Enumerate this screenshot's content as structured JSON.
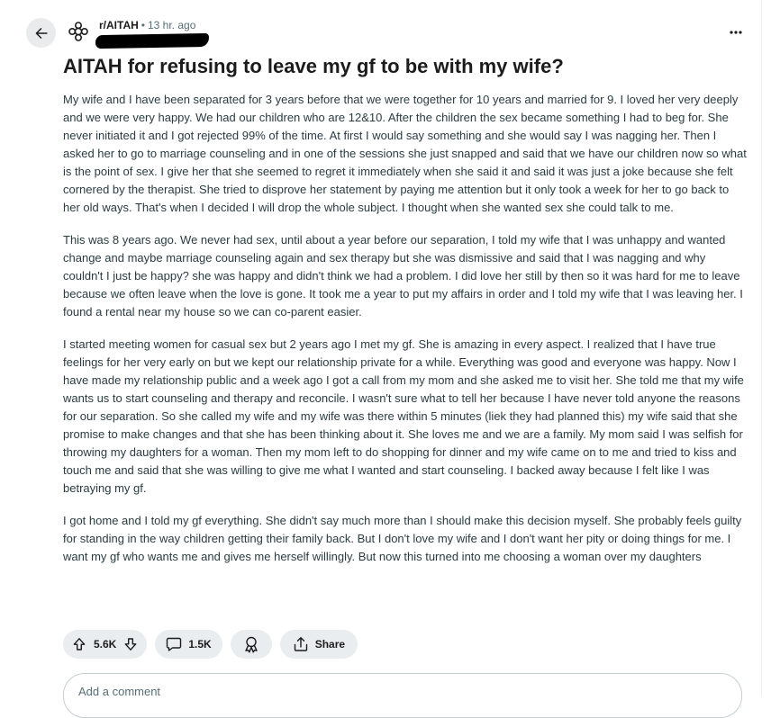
{
  "header": {
    "back_icon": "arrow-left-icon",
    "avatar_icon": "subreddit-avatar-icon",
    "subreddit": "r/AITAH",
    "separator": "•",
    "time_ago": "13 hr. ago",
    "more_icon": "ellipsis-icon"
  },
  "post": {
    "title": "AITAH for refusing to leave my gf to be with my wife?",
    "paragraphs": [
      "My wife and I have been separated for 3 years before that we were together for 10 years and married for 9. I loved her very deeply and we were very happy. We had our children who are 12&10. After the children the sex became something I had to beg for. She never initiated it and I got rejected 99% of the time. At first I would say something and she would say I was nagging her. Then I asked her to go to marriage counseling and in one of the sessions she just snapped and said that we have our children now so what is the point of sex. I give her that she seemed to regret it immediately when she said it and said it was just a joke because she felt cornered by the therapist. She tried to disprove her statement by paying me attention but it only took a week for her to go back to her old ways. That's when I decided I will drop the whole subject. I thought when she wanted sex she could talk to me.",
      "This was 8 years ago. We never had sex, until about a year before our separation, I told my wife that I was unhappy and wanted change and maybe marriage counseling again and sex therapy but she was dismissive and said that I was nagging and why couldn't I just be happy? she was happy and didn't think we had a problem. I did love her still by then so it was hard for me to leave because we often leave when the love is gone. It took me a year to put my affairs in order and I told my wife that I was leaving her. I found a rental near my house so we can co-parent easier.",
      "I started meeting women for casual sex but 2 years ago I met my gf. She is amazing in every aspect. I realized that I have true feelings for her very early on but we kept our relationship private for a while. Everything was good and everyone was happy. Now I have made my relationship public and a week ago I got a call from my mom and she asked me to visit her. She told me that my wife wants us to start counseling and therapy and reconcile. I wasn't sure what to tell her because I have never told anyone the reasons for our separation. So she called my wife and my wife was there within 5 minutes (liek they had planned this) my wife said that she promise to make changes and that she has been thinking about it. She loves me and we are a family. My mom said I was selfish for throwing my daughters for a woman. Then my mom left to do shopping for dinner and my wife came on to me and tried to kiss and touch me and said that she was willing to give me what I wanted and start counseling. I backed away because I felt like I was betraying my gf.",
      "I got home and I told my gf everything. She didn't say much more than I should make this decision myself. She probably feels guilty for standing in the way children getting their family back. But I don't love my wife and I don't want her pity or doing things for me. I want my gf who wants me and gives me herself willingly. But now this turned into me choosing a woman over my daughters"
    ]
  },
  "actions": {
    "upvote_icon": "arrow-up-icon",
    "vote_count": "5.6K",
    "downvote_icon": "arrow-down-icon",
    "comment_icon": "comment-bubble-icon",
    "comment_count": "1.5K",
    "award_icon": "award-ribbon-icon",
    "share_icon": "share-upload-icon",
    "share_label": "Share"
  },
  "comment_box": {
    "placeholder": "Add a comment"
  }
}
